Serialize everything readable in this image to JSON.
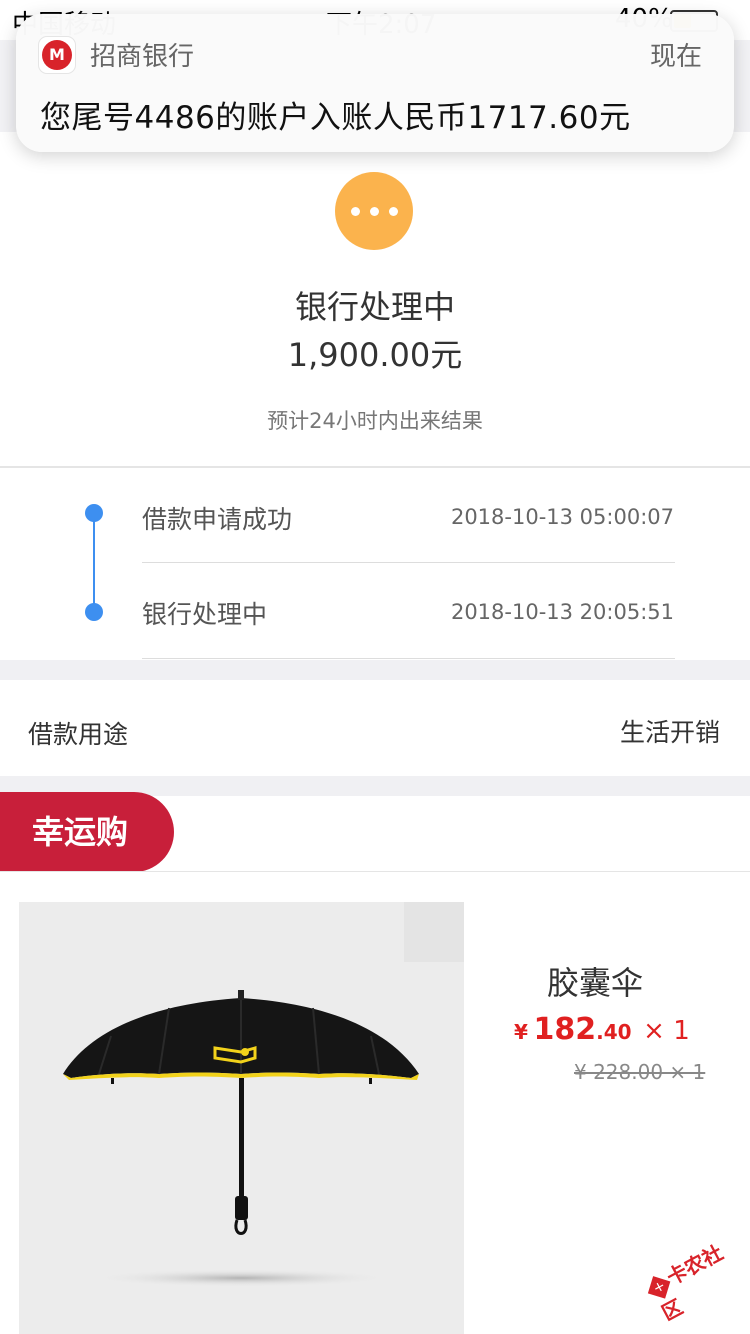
{
  "status_bar": {
    "carrier": "中国移动",
    "time": "下午2:07",
    "battery_pct": "40%",
    "battery_level": 0.4
  },
  "notification": {
    "app_name": "招商银行",
    "when": "现在",
    "message": "您尾号4486的账户入账人民币1717.60元",
    "icon": "cmb-logo-icon",
    "logo_text": "M"
  },
  "status": {
    "icon": "more-dots-icon",
    "title": "银行处理中",
    "amount": "1,900.00元",
    "eta": "预计24小时内出来结果",
    "icon_color": "#fbb34d"
  },
  "timeline": [
    {
      "label": "借款申请成功",
      "time": "2018-10-13 05:00:07"
    },
    {
      "label": "银行处理中",
      "time": "2018-10-13 20:05:51"
    }
  ],
  "purpose": {
    "label": "借款用途",
    "value": "生活开销"
  },
  "lucky": {
    "label": "幸运购",
    "color": "#c81f3a"
  },
  "product": {
    "name": "胶囊伞",
    "price_currency": "¥",
    "price_int": "182",
    "price_dec": ".40",
    "price_qty": "× 1",
    "old_price": "¥ 228.00 × 1",
    "image": "umbrella-image"
  },
  "watermark": {
    "text": "卡农社区"
  }
}
